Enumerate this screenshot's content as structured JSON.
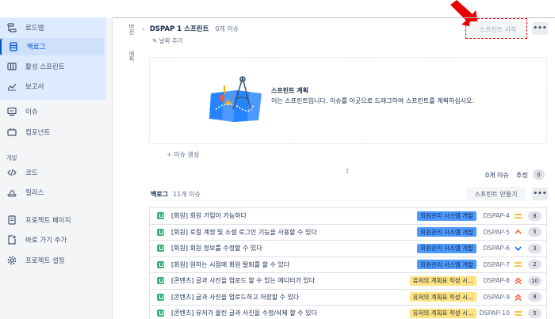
{
  "sidebar": {
    "items": [
      {
        "label": "로드맵",
        "icon": "roadmap-icon"
      },
      {
        "label": "백로그",
        "icon": "backlog-icon"
      },
      {
        "label": "활성 스프린트",
        "icon": "board-icon"
      },
      {
        "label": "보고서",
        "icon": "reports-icon"
      },
      {
        "label": "이슈",
        "icon": "issues-icon"
      },
      {
        "label": "컴포넌트",
        "icon": "components-icon"
      }
    ],
    "dev_heading": "개발",
    "dev_items": [
      {
        "label": "코드",
        "icon": "code-icon"
      },
      {
        "label": "릴리스",
        "icon": "releases-icon"
      }
    ],
    "bottom_items": [
      {
        "label": "프로젝트 페이지",
        "icon": "page-icon"
      },
      {
        "label": "바로 가기 추가",
        "icon": "add-shortcut-icon"
      },
      {
        "label": "프로젝트 설정",
        "icon": "settings-icon"
      }
    ]
  },
  "vertical_tabs": {
    "tab1": "버전",
    "tab2": "에픽"
  },
  "sprint": {
    "name": "DSPAP 1 스프린트",
    "count": "0개 이슈",
    "date_add": "날짜 추가",
    "start_button": "스프린트 시작",
    "more": "•••",
    "plan_title": "스프린트 계획",
    "plan_desc": "이는 스프린트입니다. 이슈를 이곳으로 드래그하여 스프린트를 계획하십시오.",
    "create_issue": "+ 이슈 생성",
    "issues_label": "0개 이슈",
    "estimate_label": "추정",
    "estimate_value": "0"
  },
  "backlog": {
    "title": "백로그",
    "count": "11개 이슈",
    "create_sprint_button": "스프린트 만들기",
    "more": "•••",
    "issues": [
      {
        "summary": "[회원] 회원 가입이 가능하다",
        "epic": "회원관리 시스템 개발",
        "epic_type": "blue",
        "key": "DSPAP-4",
        "priority": "medium",
        "estimate": "8"
      },
      {
        "summary": "[회원] 로컬 계정 및 소셜 로그인 기능을 사용할 수 있다",
        "epic": "회원관리 시스템 개발",
        "epic_type": "blue",
        "key": "DSPAP-5",
        "priority": "high",
        "estimate": "5"
      },
      {
        "summary": "[회원] 회원 정보를 수정할 수 있다",
        "epic": "회원관리 시스템 개발",
        "epic_type": "blue",
        "key": "DSPAP-6",
        "priority": "low",
        "estimate": "3"
      },
      {
        "summary": "[회원] 원하는 시점에 회원 탈퇴를 할 수 있다",
        "epic": "회원관리 시스템 개발",
        "epic_type": "blue",
        "key": "DSPAP-7",
        "priority": "medium",
        "estimate": "2"
      },
      {
        "summary": "[콘텐츠] 글과 사진을 업로드 할 수 있는 에디터가 있다",
        "epic": "유저의 계획표 작성 시...",
        "epic_type": "yellow",
        "key": "DSPAP-8",
        "priority": "highest",
        "estimate": "10"
      },
      {
        "summary": "[콘텐츠] 글과 사진을 업로드하고 저장할 수 있다",
        "epic": "유저의 계획표 작성 시...",
        "epic_type": "yellow",
        "key": "DSPAP-9",
        "priority": "highest",
        "estimate": "8"
      },
      {
        "summary": "[콘텐츠] 유저가 올린 글과 사진을 수정/삭제 할 수 있다",
        "epic": "유저의 계획표 작성 시...",
        "epic_type": "yellow",
        "key": "DSPAP-10",
        "priority": "medium",
        "estimate": "5"
      }
    ]
  },
  "colors": {
    "accent": "#0052cc",
    "epic_blue_bg": "#4c9aff",
    "epic_yellow_bg": "#ffe380",
    "story_green": "#36b37e",
    "highlight_red": "#e60000"
  }
}
